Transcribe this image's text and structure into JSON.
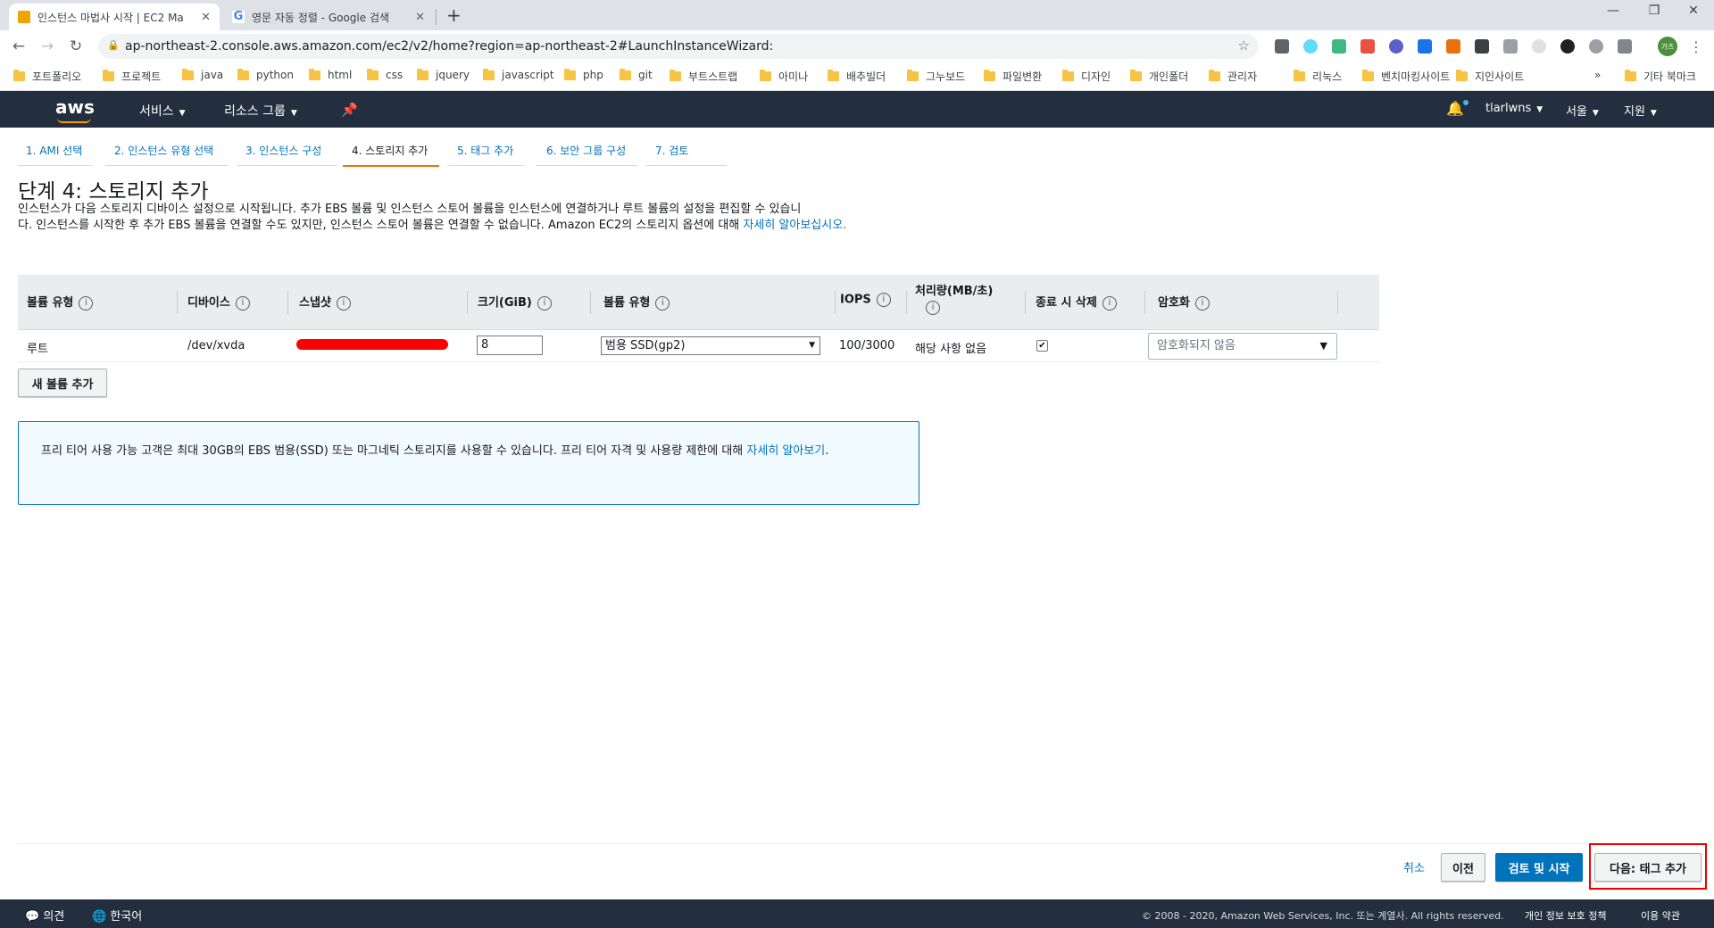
{
  "browser": {
    "tabs": [
      {
        "title": "인스턴스 마법사 시작 | EC2 Ma",
        "active": true,
        "favicon_color": "#f0a400"
      },
      {
        "title": "영문 자동 정렬 - Google 검색",
        "active": false,
        "favicon_color": "#4285f4"
      }
    ],
    "url": "ap-northeast-2.console.aws.amazon.com/ec2/v2/home?region=ap-northeast-2#LaunchInstanceWizard:",
    "avatar_text": "가즈",
    "bookmarks": [
      "포트폴리오",
      "프로젝트",
      "java",
      "python",
      "html",
      "css",
      "jquery",
      "javascript",
      "php",
      "git",
      "부트스트랩",
      "아미나",
      "배추빌더",
      "그누보드",
      "파일변환",
      "디자인",
      "개인폴더",
      "관리자",
      "리눅스",
      "벤치마킹사이트",
      "지인사이트"
    ],
    "bookmarks_more": "»",
    "other_bookmarks": "기타 북마크"
  },
  "aws_nav": {
    "logo": "aws",
    "services": "서비스",
    "resource_groups": "리소스 그룹",
    "user": "tlarlwns",
    "region": "서울",
    "support": "지원"
  },
  "steps": [
    "1. AMI 선택",
    "2. 인스턴스 유형 선택",
    "3. 인스턴스 구성",
    "4. 스토리지 추가",
    "5. 태그 추가",
    "6. 보안 그룹 구성",
    "7. 검토"
  ],
  "page": {
    "title": "단계 4: 스토리지 추가",
    "desc_line1": "인스턴스가 다음 스토리지 디바이스 설정으로 시작됩니다. 추가 EBS 볼륨 및 인스턴스 스토어 볼륨을 인스턴스에 연결하거나 루트 볼륨의 설정을 편집할 수 있습니",
    "desc_line2": "다. 인스턴스를 시작한 후 추가 EBS 볼륨을 연결할 수도 있지만, 인스턴스 스토어 볼륨은 연결할 수 없습니다. Amazon EC2의 스토리지 옵션에 대해 ",
    "desc_link": "자세히 알아보십시오."
  },
  "table": {
    "headers": {
      "volume_type": "볼륨 유형",
      "device": "디바이스",
      "snapshot": "스냅샷",
      "size": "크기(GiB)",
      "volume_kind": "볼륨 유형",
      "iops": "IOPS",
      "throughput": "처리량(MB/초)",
      "delete_on_term": "종료 시 삭제",
      "encryption": "암호화"
    },
    "row": {
      "volume_type": "루트",
      "device": "/dev/xvda",
      "size": "8",
      "volume_kind": "범용 SSD(gp2)",
      "iops": "100/3000",
      "throughput": "해당 사항 없음",
      "delete_on_term": true,
      "encryption": "암호화되지 않음"
    }
  },
  "buttons": {
    "add_volume": "새 볼륨 추가",
    "cancel": "취소",
    "previous": "이전",
    "review_launch": "검토 및 시작",
    "next": "다음: 태그 추가"
  },
  "infobox": {
    "text": "프리 티어 사용 가능 고객은 최대 30GB의 EBS 범용(SSD) 또는 마그네틱 스토리지를 사용할 수 있습니다. 프리 티어 자격 및 사용량 제한에 대해 ",
    "link": "자세히 알아보기",
    "end": "."
  },
  "footer": {
    "feedback": "의견",
    "language": "한국어",
    "copyright": "© 2008 - 2020, Amazon Web Services, Inc. 또는 계열사. All rights reserved.",
    "privacy": "개인 정보 보호 정책",
    "terms": "이용 약관"
  },
  "colors": {
    "aws_dark": "#232f3e",
    "accent_orange": "#ec7211",
    "link_blue": "#0073bb",
    "highlight_red": "#ee0000"
  }
}
